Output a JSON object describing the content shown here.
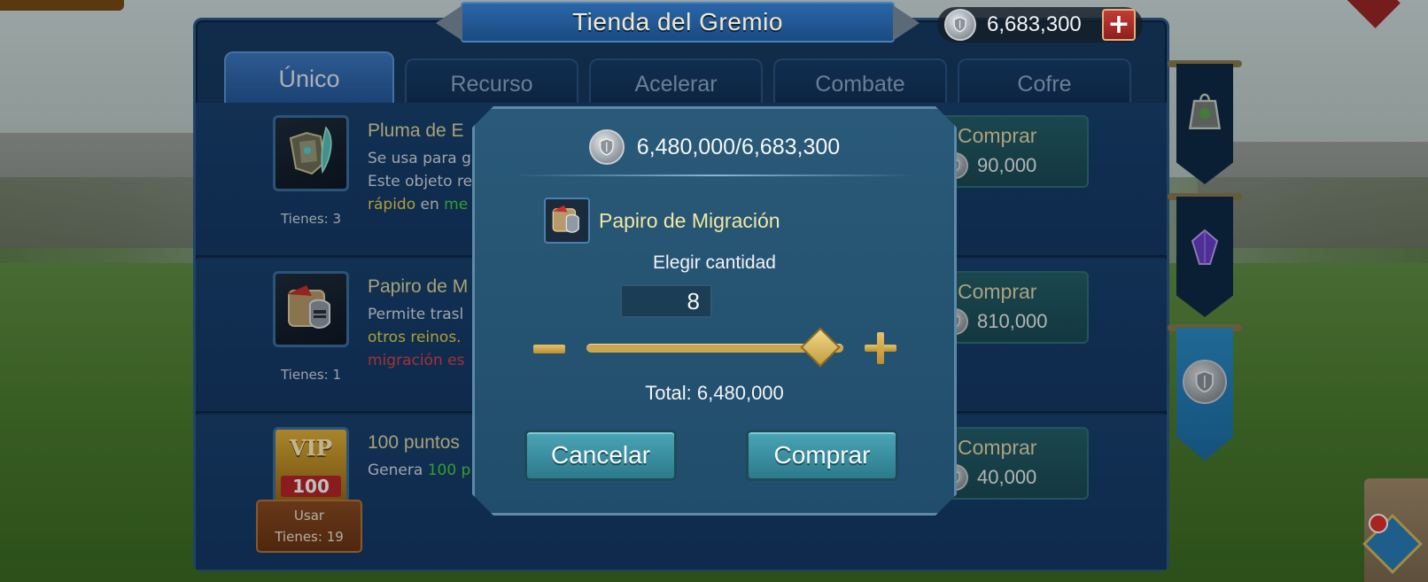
{
  "header": {
    "title": "Tienda del Gremio",
    "currency_amount": "6,683,300",
    "add_currency_icon": "plus-icon",
    "currency_icon": "guild-coin-shield-icon"
  },
  "tabs": [
    {
      "label": "Único",
      "active": true
    },
    {
      "label": "Recurso",
      "active": false
    },
    {
      "label": "Acelerar",
      "active": false
    },
    {
      "label": "Combate",
      "active": false
    },
    {
      "label": "Cofre",
      "active": false
    }
  ],
  "items": [
    {
      "name": "Pluma de E",
      "desc_line1": "Se usa para g",
      "desc_line2": "Este objeto re",
      "desc_line3_a": "rápido",
      "desc_line3_b": " en ",
      "desc_line3_c": "me",
      "have": "Tienes: 3",
      "buy_label": "Comprar",
      "price": "90,000",
      "icon": "feather-armor-icon"
    },
    {
      "name": "Papiro de M",
      "desc_line1": "Permite trasl",
      "desc_line2": "otros reinos.",
      "desc_line3": "migración es",
      "have": "Tienes: 1",
      "buy_label": "Comprar",
      "price": "810,000",
      "icon": "migration-scroll-icon"
    },
    {
      "name": "100 puntos",
      "desc_line1_a": "Genera ",
      "desc_line1_b": "100 p",
      "use_label": "Usar",
      "have": "Tienes: 19",
      "buy_label": "Comprar",
      "price": "40,000",
      "icon": "vip-100-icon",
      "vip_text": "VIP",
      "vip_value": "100"
    }
  ],
  "side_tabs": [
    {
      "icon": "guild-shop-bag-icon",
      "active": false
    },
    {
      "icon": "purple-gem-icon",
      "active": false
    },
    {
      "icon": "guild-coin-shield-icon",
      "active": true
    }
  ],
  "modal": {
    "balance": "6,480,000/6,683,300",
    "item_name": "Papiro de Migración",
    "choose_label": "Elegir cantidad",
    "quantity": "8",
    "slider_fraction": 0.91,
    "total": "Total: 6,480,000",
    "cancel_label": "Cancelar",
    "confirm_label": "Comprar"
  }
}
